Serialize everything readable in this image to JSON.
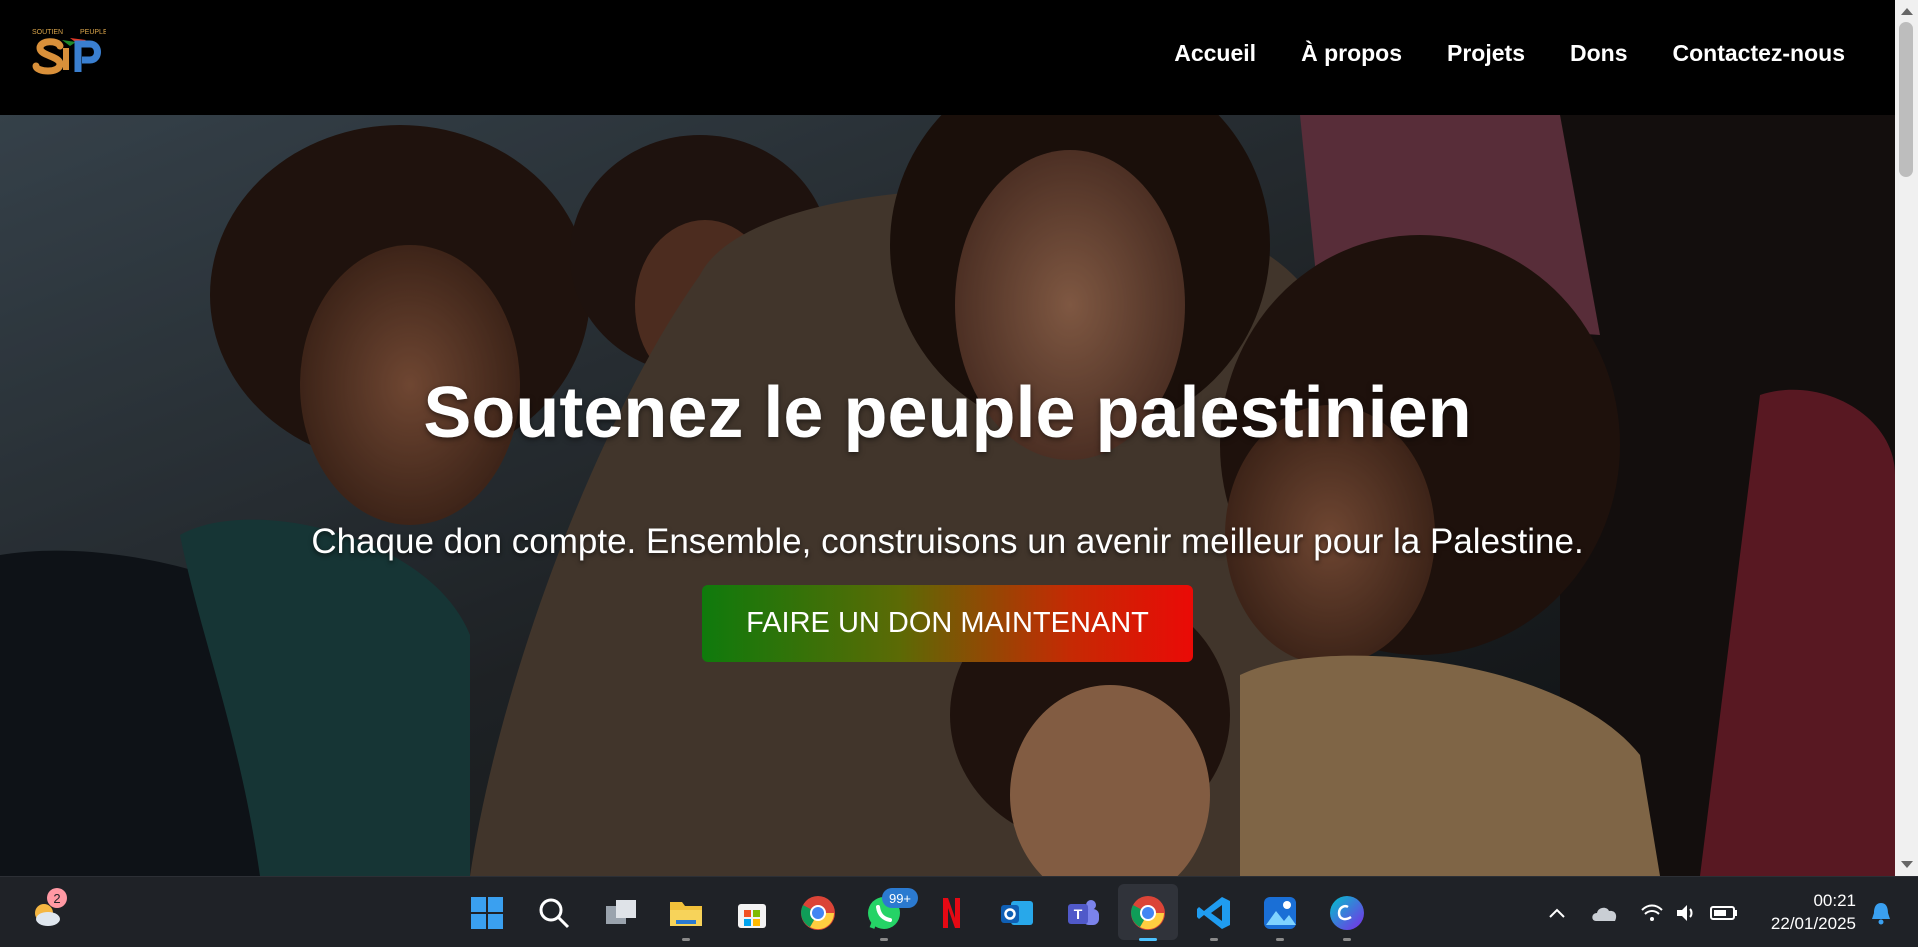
{
  "nav": {
    "items": [
      {
        "label": "Accueil"
      },
      {
        "label": "À propos"
      },
      {
        "label": "Projets"
      },
      {
        "label": "Dons"
      },
      {
        "label": "Contactez-nous"
      }
    ]
  },
  "hero": {
    "title": "Soutenez le peuple palestinien",
    "subtitle": "Chaque don compte. Ensemble, construisons un avenir meilleur pour la Palestine.",
    "cta_label": "FAIRE UN DON MAINTENANT"
  },
  "taskbar": {
    "weather_badge": "2",
    "whatsapp_badge": "99+",
    "time": "00:21",
    "date": "22/01/2025",
    "apps": [
      "windows-start-icon",
      "search-icon",
      "task-view-icon",
      "file-explorer-icon",
      "microsoft-store-icon",
      "chrome-icon",
      "whatsapp-icon",
      "netflix-icon",
      "outlook-icon",
      "teams-icon",
      "chrome-active-icon",
      "vscode-icon",
      "photos-icon",
      "canva-icon"
    ]
  },
  "colors": {
    "button_gradient_start": "#0f7a0c",
    "button_gradient_end": "#ea0a06",
    "header_bg": "#000000",
    "taskbar_bg": "#1f2227"
  }
}
